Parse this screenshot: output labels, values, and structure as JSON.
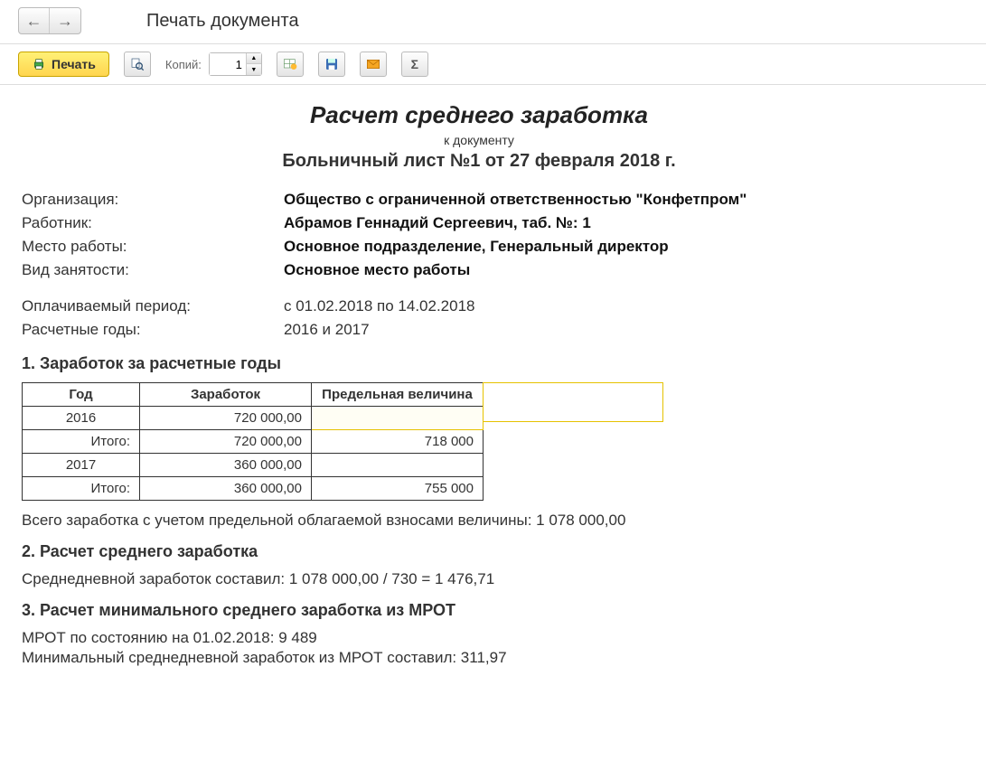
{
  "window": {
    "title": "Печать документа"
  },
  "toolbar": {
    "print_label": "Печать",
    "copies_label": "Копий:",
    "copies_value": "1"
  },
  "doc": {
    "title": "Расчет среднего заработка",
    "subtitle": "к документу",
    "ref": "Больничный лист №1 от 27 февраля 2018 г.",
    "info": {
      "org_label": "Организация:",
      "org_value": "Общество с ограниченной ответственностью \"Конфетпром\"",
      "emp_label": "Работник:",
      "emp_value": "Абрамов Геннадий Сергеевич, таб. №: 1",
      "place_label": "Место работы:",
      "place_value": "Основное подразделение, Генеральный директор",
      "type_label": "Вид занятости:",
      "type_value": "Основное место работы"
    },
    "period": {
      "paid_label": "Оплачиваемый период:",
      "paid_value": "с 01.02.2018 по 14.02.2018",
      "years_label": "Расчетные годы:",
      "years_value": "2016 и 2017"
    },
    "s1": {
      "head": "1. Заработок за расчетные годы",
      "th_year": "Год",
      "th_earn": "Заработок",
      "th_limit": "Предельная величина",
      "r1_year": "2016",
      "r1_earn": "720 000,00",
      "r1_limit": "",
      "r1t_label": "Итого:",
      "r1t_earn": "720 000,00",
      "r1t_limit": "718 000",
      "r2_year": "2017",
      "r2_earn": "360 000,00",
      "r2_limit": "",
      "r2t_label": "Итого:",
      "r2t_earn": "360 000,00",
      "r2t_limit": "755 000",
      "total_text": "Всего заработка с учетом предельной облагаемой взносами величины: 1 078 000,00"
    },
    "s2": {
      "head": "2. Расчет среднего заработка",
      "text": "Среднедневной заработок составил: 1 078 000,00 / 730 = 1 476,71"
    },
    "s3": {
      "head": "3. Расчет минимального среднего заработка из МРОТ",
      "l1": "МРОТ по состоянию на 01.02.2018: 9 489",
      "l2": "Минимальный среднедневной заработок из МРОТ составил: 311,97"
    }
  }
}
